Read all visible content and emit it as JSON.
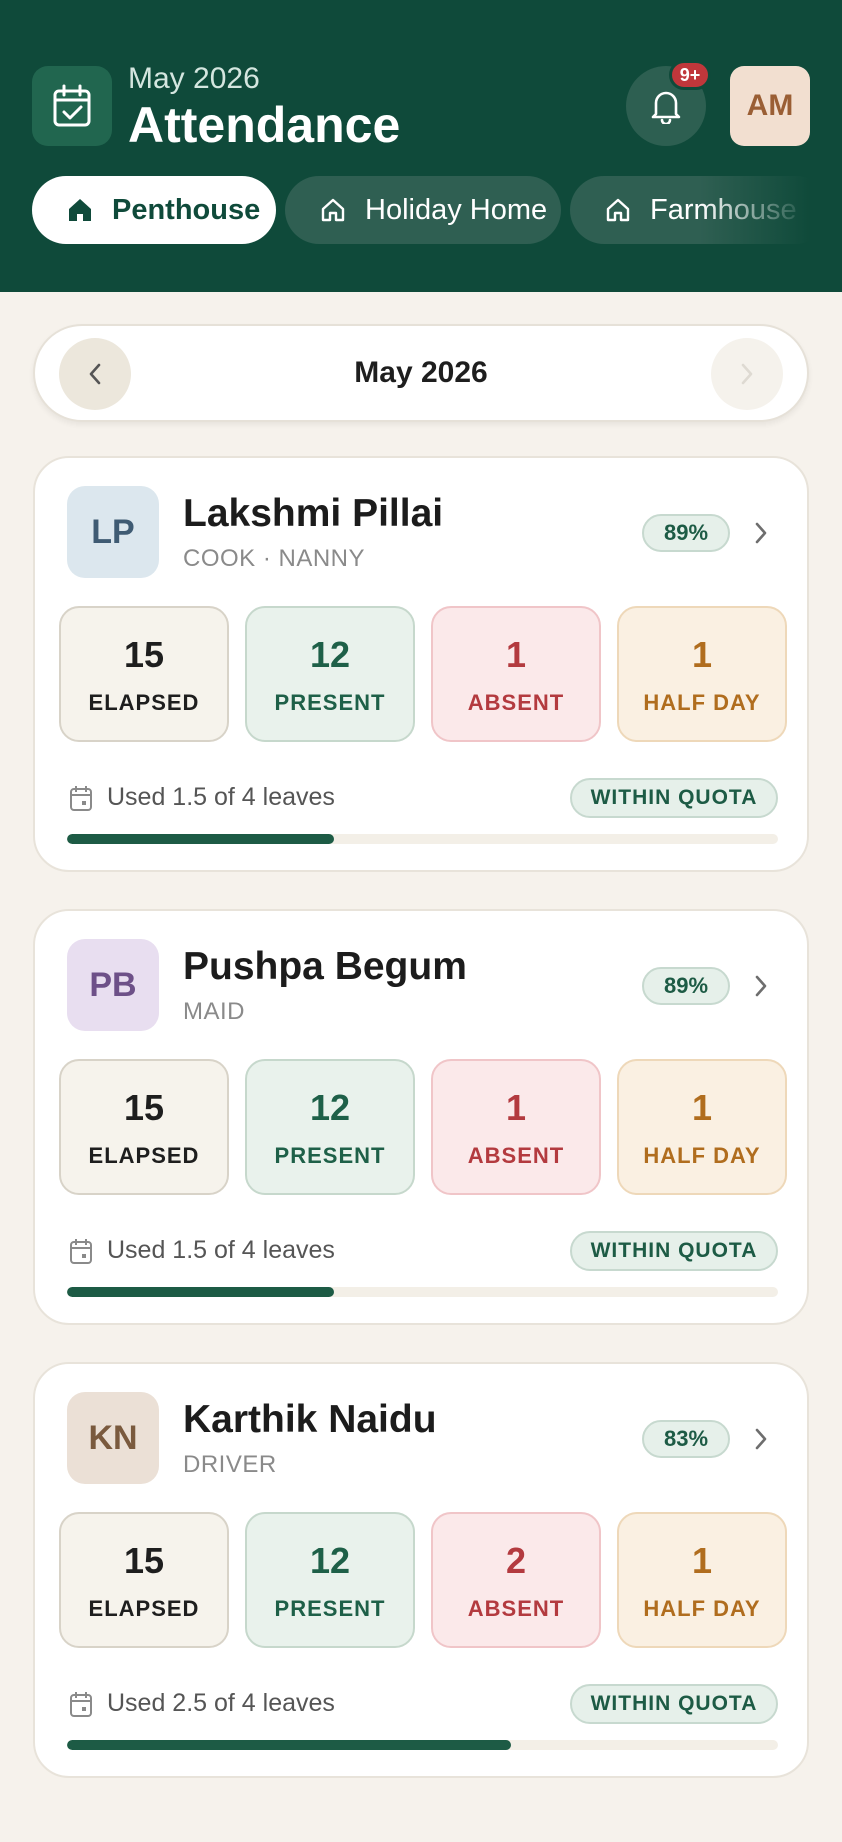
{
  "header": {
    "subtitle": "May 2026",
    "title": "Attendance",
    "notification_badge": "9+",
    "user_initials": "AM"
  },
  "tabs": [
    {
      "label": "Penthouse",
      "active": true
    },
    {
      "label": "Holiday Home",
      "active": false
    },
    {
      "label": "Farmhouse",
      "active": false
    }
  ],
  "month_selector": {
    "label": "May 2026"
  },
  "staff": [
    {
      "initials": "LP",
      "name": "Lakshmi Pillai",
      "role": "COOK · NANNY",
      "percent": "89%",
      "avatar_bg": "#dce7ee",
      "avatar_fg": "#3f5b73",
      "stats": {
        "elapsed": {
          "value": "15",
          "label": "ELAPSED"
        },
        "present": {
          "value": "12",
          "label": "PRESENT"
        },
        "absent": {
          "value": "1",
          "label": "ABSENT"
        },
        "half_day": {
          "value": "1",
          "label": "HALF DAY"
        }
      },
      "leave_text": "Used 1.5 of 4 leaves",
      "quota_status": "WITHIN QUOTA",
      "leave_used_fraction": 0.375
    },
    {
      "initials": "PB",
      "name": "Pushpa Begum",
      "role": "MAID",
      "percent": "89%",
      "avatar_bg": "#e8def0",
      "avatar_fg": "#6d5088",
      "stats": {
        "elapsed": {
          "value": "15",
          "label": "ELAPSED"
        },
        "present": {
          "value": "12",
          "label": "PRESENT"
        },
        "absent": {
          "value": "1",
          "label": "ABSENT"
        },
        "half_day": {
          "value": "1",
          "label": "HALF DAY"
        }
      },
      "leave_text": "Used 1.5 of 4 leaves",
      "quota_status": "WITHIN QUOTA",
      "leave_used_fraction": 0.375
    },
    {
      "initials": "KN",
      "name": "Karthik Naidu",
      "role": "DRIVER",
      "percent": "83%",
      "avatar_bg": "#ebe0d6",
      "avatar_fg": "#7a5a3e",
      "stats": {
        "elapsed": {
          "value": "15",
          "label": "ELAPSED"
        },
        "present": {
          "value": "12",
          "label": "PRESENT"
        },
        "absent": {
          "value": "2",
          "label": "ABSENT"
        },
        "half_day": {
          "value": "1",
          "label": "HALF DAY"
        }
      },
      "leave_text": "Used 2.5 of 4 leaves",
      "quota_status": "WITHIN QUOTA",
      "leave_used_fraction": 0.625
    }
  ],
  "colors": {
    "brand_dark_green": "#0f4a3a",
    "present_green": "#1e6048",
    "absent_red": "#b33a3f",
    "half_day_amber": "#b06d1e",
    "badge_red": "#c0373b"
  },
  "icons": {
    "app": "calendar-check-icon",
    "notification": "bell-icon",
    "tab": "home-icon",
    "prev": "chevron-left-icon",
    "next": "chevron-right-icon",
    "leave": "calendar-icon"
  }
}
